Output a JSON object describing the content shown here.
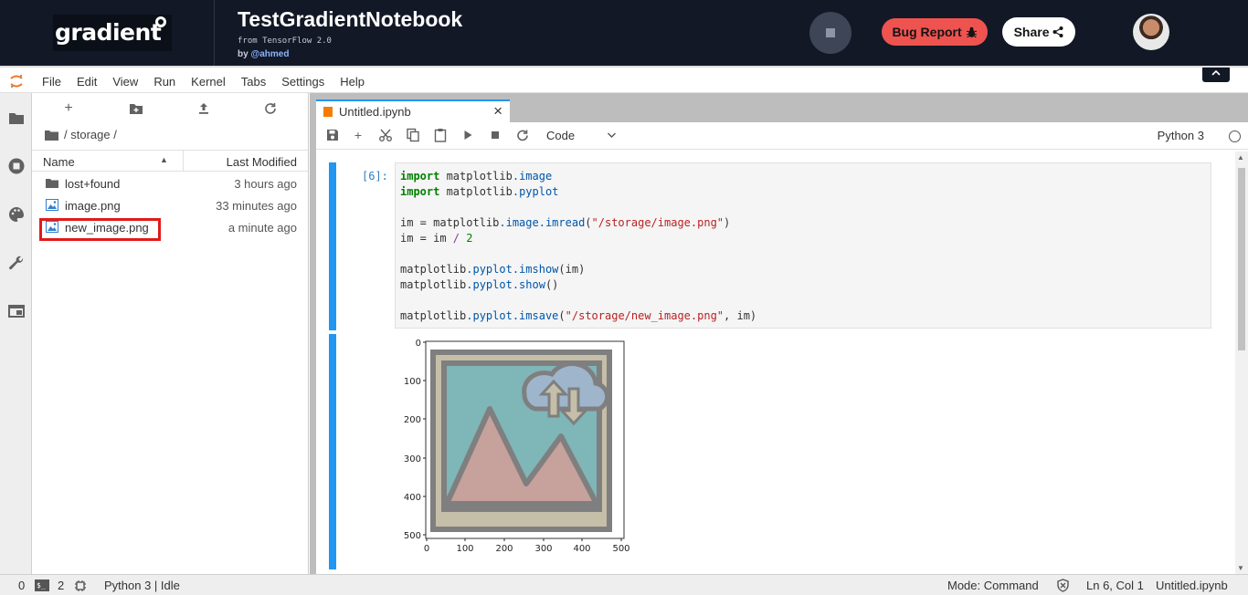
{
  "header": {
    "logo_text": "gradient",
    "notebook_title": "TestGradientNotebook",
    "subtitle": "from TensorFlow 2.0",
    "by_prefix": "by",
    "author": "@ahmed",
    "bug_report_label": "Bug Report",
    "share_label": "Share"
  },
  "menu": [
    "File",
    "Edit",
    "View",
    "Run",
    "Kernel",
    "Tabs",
    "Settings",
    "Help"
  ],
  "left_sidebar_icons": [
    "folder-icon",
    "running-icon",
    "palette-icon",
    "wrench-icon",
    "tabs-icon"
  ],
  "file_browser": {
    "breadcrumb": "/ storage /",
    "columns": {
      "name": "Name",
      "modified": "Last Modified"
    },
    "files": [
      {
        "name": "lost+found",
        "modified": "3 hours ago",
        "type": "folder"
      },
      {
        "name": "image.png",
        "modified": "33 minutes ago",
        "type": "image"
      },
      {
        "name": "new_image.png",
        "modified": "a minute ago",
        "type": "image",
        "highlighted": true
      }
    ]
  },
  "tab": {
    "label": "Untitled.ipynb"
  },
  "notebook_toolbar": {
    "cell_type": "Code",
    "kernel": "Python 3"
  },
  "cell": {
    "prompt": "[6]:",
    "code": [
      "import matplotlib.image",
      "import matplotlib.pyplot",
      "",
      "im = matplotlib.image.imread(\"/storage/image.png\")",
      "im = im / 2",
      "",
      "matplotlib.pyplot.imshow(im)",
      "matplotlib.pyplot.show()",
      "",
      "matplotlib.pyplot.imsave(\"/storage/new_image.png\", im)"
    ]
  },
  "output_plot": {
    "x_ticks": [
      "0",
      "100",
      "200",
      "300",
      "400",
      "500"
    ],
    "y_ticks": [
      "0",
      "100",
      "200",
      "300",
      "400",
      "500"
    ]
  },
  "status": {
    "count_a": "0",
    "count_b": "2",
    "kernel_status": "Python 3 | Idle",
    "mode": "Mode: Command",
    "position": "Ln 6, Col 1",
    "filename": "Untitled.ipynb"
  }
}
